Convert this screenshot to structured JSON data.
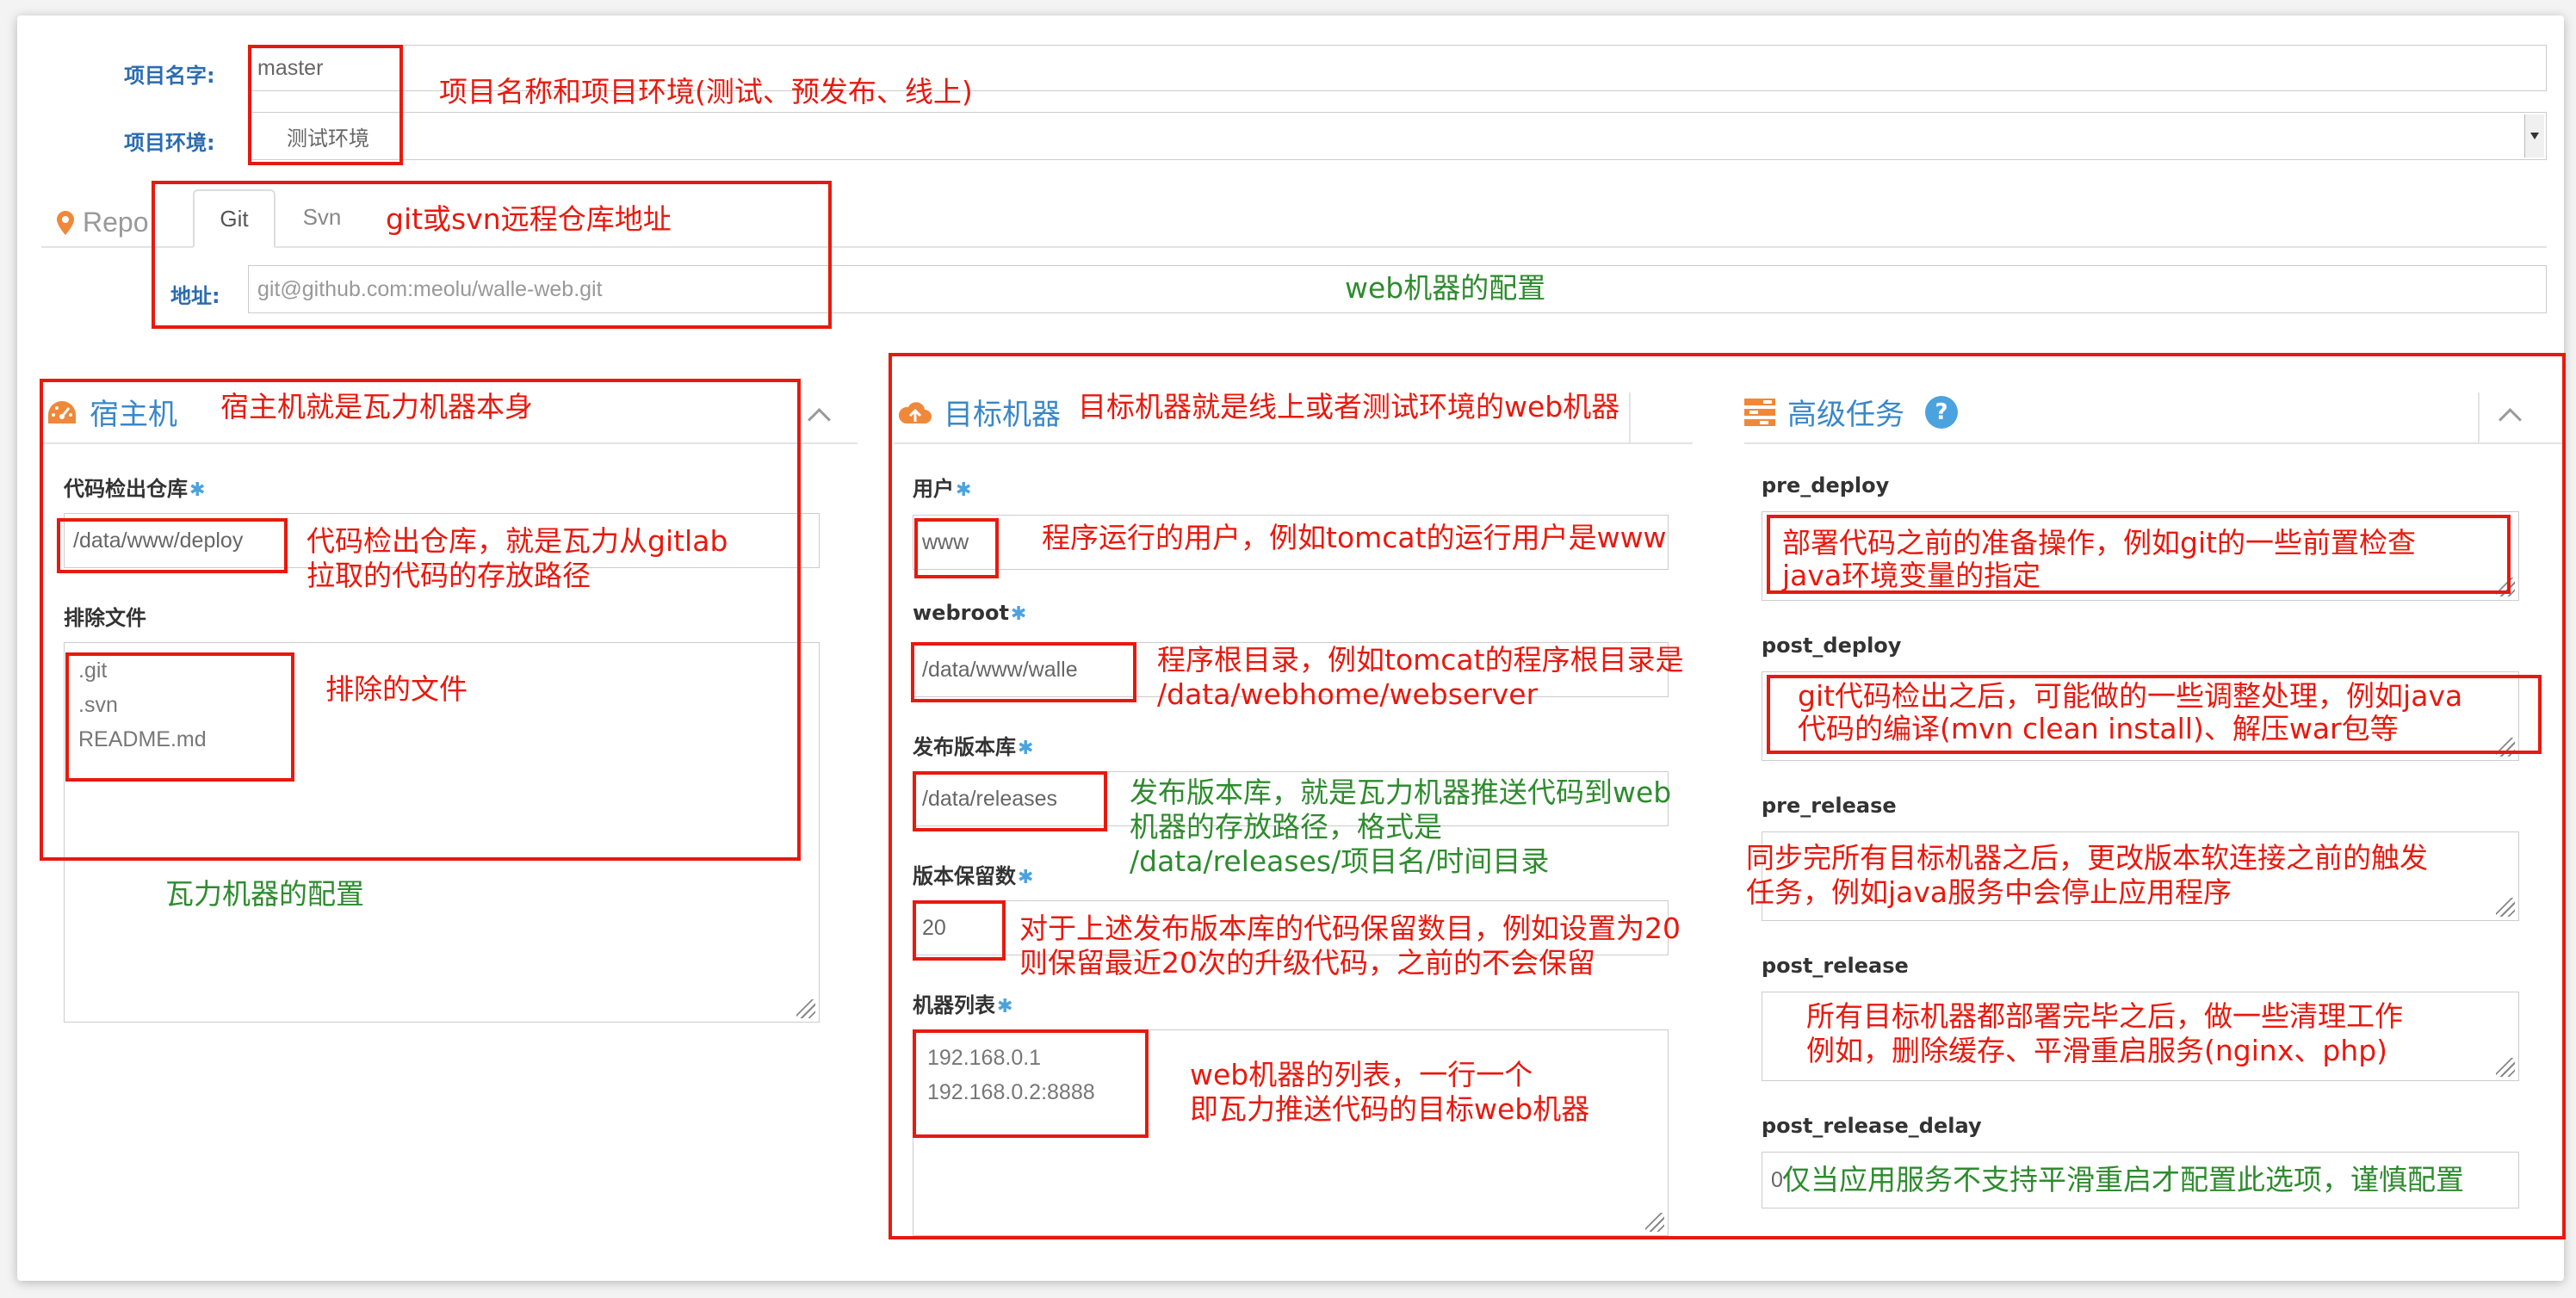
{
  "project": {
    "name_label": "项目名字:",
    "name_value": "master",
    "env_label": "项目环境:",
    "env_value": "测试环境"
  },
  "repo": {
    "title": "Repo",
    "tabs": [
      {
        "label": "Git"
      },
      {
        "label": "Svn"
      }
    ],
    "address_label": "地址:",
    "address_placeholder": "git@github.com:meolu/walle-web.git"
  },
  "host": {
    "title": "宿主机",
    "checkout_label": "代码检出仓库",
    "checkout_value": "/data/www/deploy",
    "exclude_label": "排除文件",
    "exclude_lines": [
      ".git",
      ".svn",
      "README.md"
    ]
  },
  "target": {
    "title": "目标机器",
    "user_label": "用户",
    "user_value": "www",
    "webroot_label": "webroot",
    "webroot_value": "/data/www/walle",
    "releases_label": "发布版本库",
    "releases_value": "/data/releases",
    "keep_label": "版本保留数",
    "keep_value": "20",
    "hosts_label": "机器列表",
    "hosts_lines": [
      "192.168.0.1",
      "192.168.0.2:8888"
    ]
  },
  "advanced": {
    "title": "高级任务",
    "help_glyph": "?",
    "pre_deploy_label": "pre_deploy",
    "post_deploy_label": "post_deploy",
    "pre_release_label": "pre_release",
    "post_release_label": "post_release",
    "post_release_delay_label": "post_release_delay",
    "post_release_delay_value": "0"
  },
  "annotations": {
    "project": "项目名称和项目环境(测试、预发布、线上)",
    "repo": "git或svn远程仓库地址",
    "web_config": "web机器的配置",
    "host": "宿主机就是瓦力机器本身",
    "checkout_1": "代码检出仓库，就是瓦力从gitlab",
    "checkout_2": "拉取的代码的存放路径",
    "exclude": "排除的文件",
    "walle_config": "瓦力机器的配置",
    "target": "目标机器就是线上或者测试环境的web机器",
    "user": "程序运行的用户，例如tomcat的运行用户是www",
    "webroot_1": "程序根目录，例如tomcat的程序根目录是",
    "webroot_2": "/data/webhome/webserver",
    "releases_1": "发布版本库，就是瓦力机器推送代码到web",
    "releases_2": "机器的存放路径，格式是",
    "releases_3": "/data/releases/项目名/时间目录",
    "keep_1": "对于上述发布版本库的代码保留数目，例如设置为20",
    "keep_2": "则保留最近20次的升级代码，之前的不会保留",
    "hosts_1": "web机器的列表，一行一个",
    "hosts_2": "即瓦力推送代码的目标web机器",
    "pre_deploy_1": "部署代码之前的准备操作，例如git的一些前置检查",
    "pre_deploy_2": "java环境变量的指定",
    "post_deploy_1": "git代码检出之后，可能做的一些调整处理，例如java",
    "post_deploy_2": "代码的编译(mvn clean install)、解压war包等",
    "pre_release_1": "同步完所有目标机器之后，更改版本软连接之前的触发",
    "pre_release_2": "任务，例如java服务中会停止应用程序",
    "post_release_1": "所有目标机器都部署完毕之后，做一些清理工作",
    "post_release_2": "例如，删除缓存、平滑重启服务(nginx、php)",
    "delay": "仅当应用服务不支持平滑重启才配置此选项，谨慎配置"
  },
  "colors": {
    "annotation_red": "#e8190e",
    "annotation_green": "#2e8b2e",
    "label_blue": "#2b6cb0",
    "accent_blue": "#3a87c8",
    "icon_orange": "#f0883a"
  }
}
